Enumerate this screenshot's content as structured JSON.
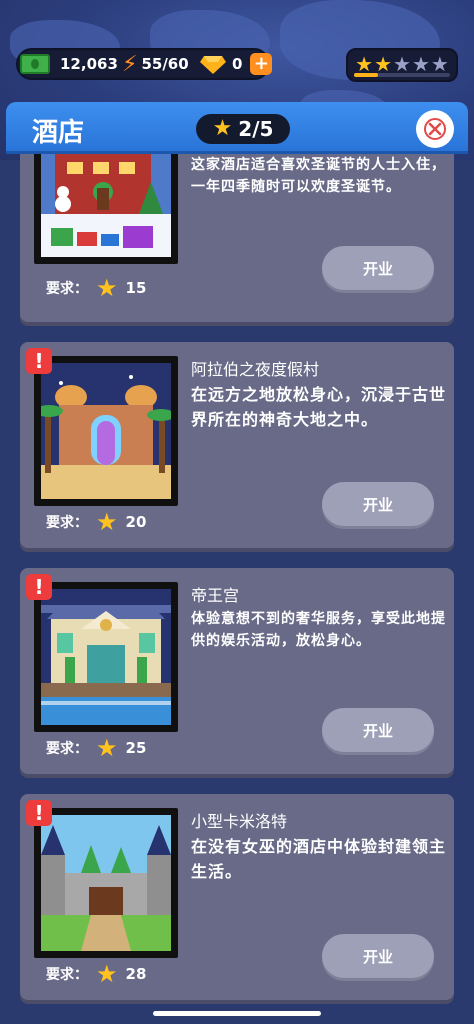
{
  "topbar": {
    "cash": "12,063",
    "energy": "55/60",
    "gems": "0",
    "plus": "+",
    "stars_filled": 2,
    "stars_total": 5,
    "star_progress": 0.25
  },
  "header": {
    "title": "酒店",
    "progress": "2/5",
    "close_icon": "close-icon"
  },
  "cards": [
    {
      "name": "",
      "description": "这家酒店适合喜欢圣诞节的人士入住，一年四季随时可以欢度圣诞节。",
      "req_label": "要求：",
      "req_value": "15",
      "button": "开业",
      "alert": false
    },
    {
      "name": "阿拉伯之夜度假村",
      "description": "在远方之地放松身心，沉浸于古世界所在的神奇大地之中。",
      "req_label": "要求：",
      "req_value": "20",
      "button": "开业",
      "alert": true
    },
    {
      "name": "帝王宫",
      "description": "体验意想不到的奢华服务，享受此地提供的娱乐活动，放松身心。",
      "req_label": "要求：",
      "req_value": "25",
      "button": "开业",
      "alert": true
    },
    {
      "name": "小型卡米洛特",
      "description": "在没有女巫的酒店中体验封建领主生活。",
      "req_label": "要求：",
      "req_value": "28",
      "button": "开业",
      "alert": true
    }
  ],
  "icons": {
    "alert": "!",
    "star": "★",
    "bolt": "⚡"
  },
  "colors": {
    "accent": "#2a74d8",
    "card": "#696a88",
    "button": "#9ea0b8",
    "star": "#ffc21e",
    "alert": "#ee3b3b"
  }
}
